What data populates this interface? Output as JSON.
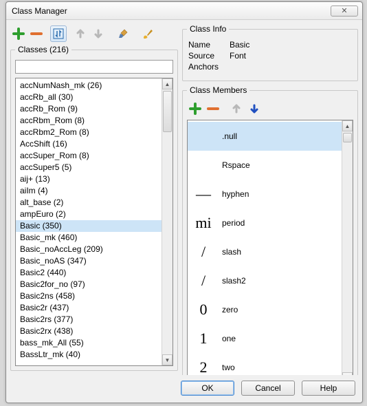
{
  "window": {
    "title": "Class Manager",
    "close_glyph": "✕"
  },
  "classes_group": {
    "legend": "Classes (216)",
    "search_value": "",
    "items": [
      "accNumNash_mk (26)",
      "accRb_all (30)",
      "accRb_Rom (9)",
      "accRbm_Rom (8)",
      "accRbm2_Rom (8)",
      "AccShift (16)",
      "accSuper_Rom (8)",
      "accSuper5 (5)",
      "aij+ (13)",
      "aiIm (4)",
      "alt_base (2)",
      "ampEuro (2)",
      "Basic (350)",
      "Basic_mk (460)",
      "Basic_noAccLeg (209)",
      "Basic_noAS (347)",
      "Basic2 (440)",
      "Basic2for_no (97)",
      "Basic2ns (458)",
      "Basic2r (437)",
      "Basic2rs (377)",
      "Basic2rx (438)",
      "bass_mk_All (55)",
      "BassLtr_mk (40)"
    ],
    "selected_index": 12
  },
  "class_info": {
    "legend": "Class Info",
    "rows": [
      {
        "label": "Name",
        "value": "Basic"
      },
      {
        "label": "Source",
        "value": "Font"
      },
      {
        "label": "Anchors",
        "value": ""
      }
    ]
  },
  "class_members": {
    "legend": "Class Members",
    "items": [
      {
        "preview": "",
        "name": ".null"
      },
      {
        "preview": "",
        "name": "Rspace"
      },
      {
        "preview": "—",
        "name": "hyphen"
      },
      {
        "preview": "mi",
        "name": "period"
      },
      {
        "preview": "/",
        "name": "slash"
      },
      {
        "preview": "/",
        "name": "slash2"
      },
      {
        "preview": "0",
        "name": "zero"
      },
      {
        "preview": "1",
        "name": "one"
      },
      {
        "preview": "2",
        "name": "two"
      }
    ],
    "selected_index": 0
  },
  "buttons": {
    "ok": "OK",
    "cancel": "Cancel",
    "help": "Help"
  }
}
